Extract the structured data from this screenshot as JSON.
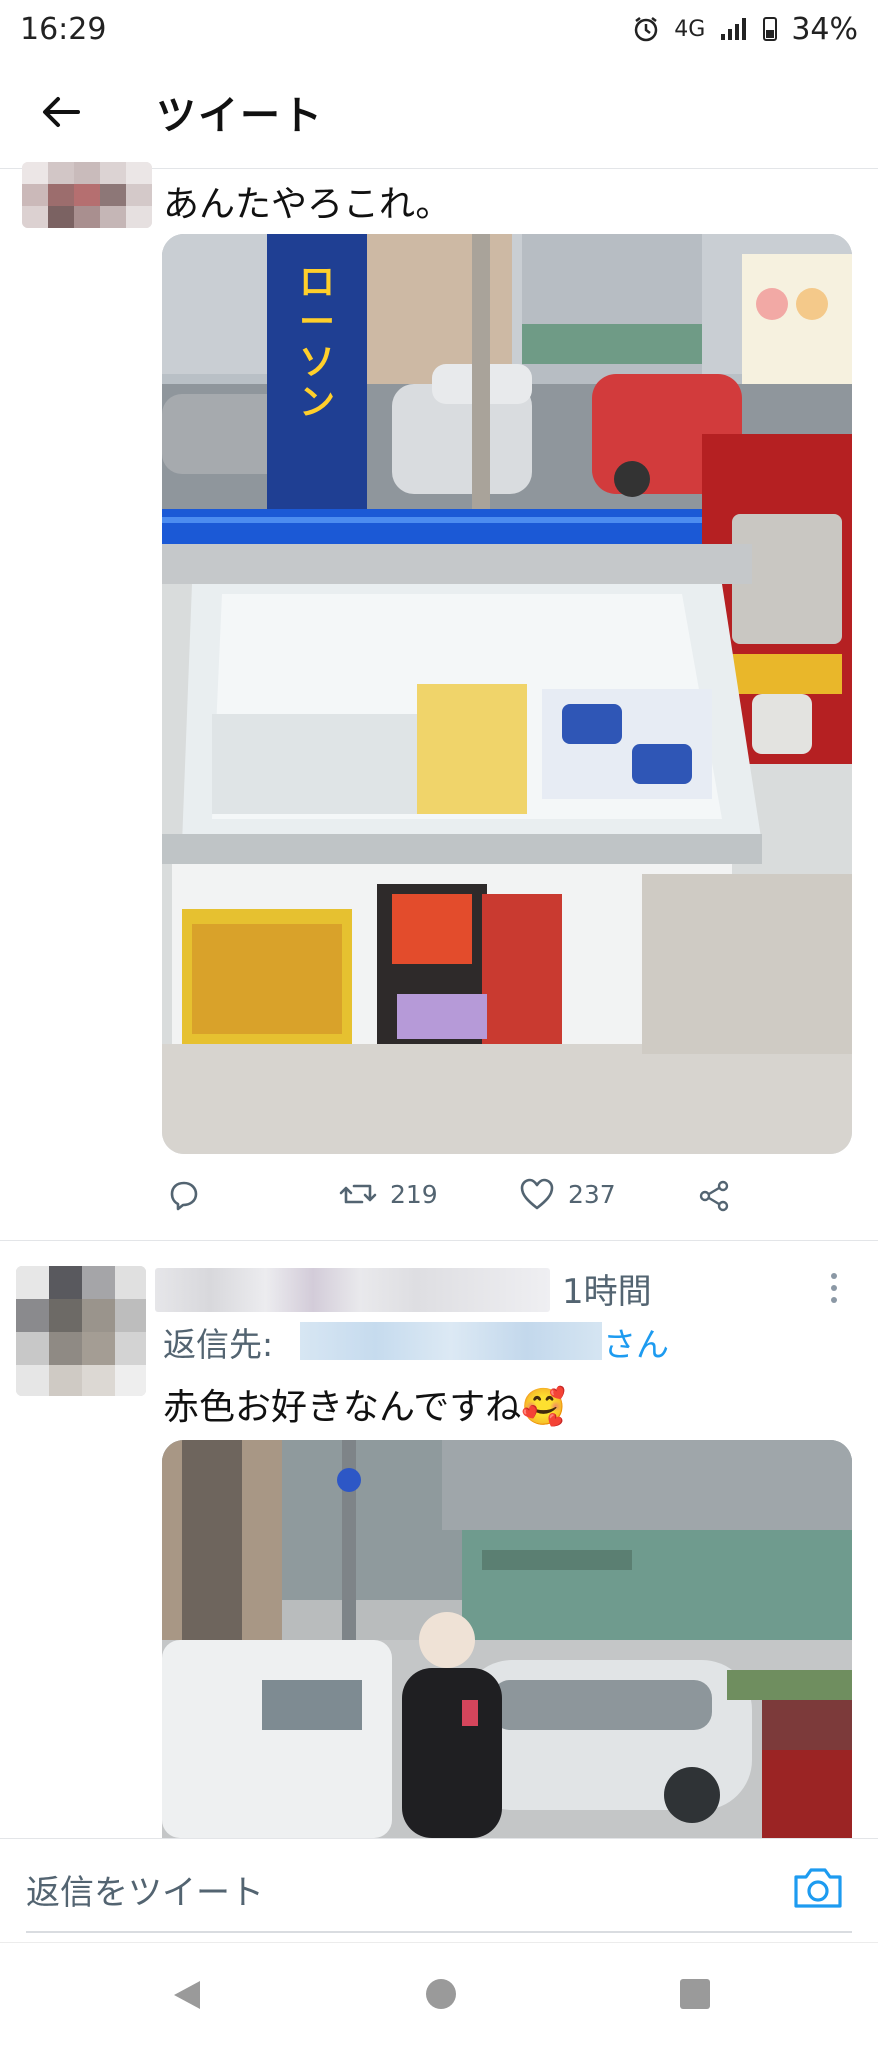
{
  "status_bar": {
    "time": "16:29",
    "network": "4G",
    "battery": "34%",
    "icons": [
      "alarm-icon",
      "signal-icon",
      "battery-icon"
    ]
  },
  "header": {
    "title": "ツイート",
    "back_icon": "arrow-left-icon"
  },
  "main_tweet": {
    "text": "あんたやろこれ。",
    "stats": {
      "retweets": "219",
      "likes": "237"
    },
    "action_icons": [
      "reply-icon",
      "retweet-icon",
      "like-icon",
      "share-icon"
    ]
  },
  "reply": {
    "time": "1時間",
    "reply_to_label": "返信先:",
    "reply_to_suffix": "さん",
    "text": "赤色お好きなんですね",
    "emoji": "🥰"
  },
  "composer": {
    "placeholder": "返信をツイート",
    "camera_icon": "camera-icon"
  },
  "colors": {
    "accent": "#1d9bf0",
    "muted_text": "#536471",
    "divider": "#e3e5e8"
  }
}
